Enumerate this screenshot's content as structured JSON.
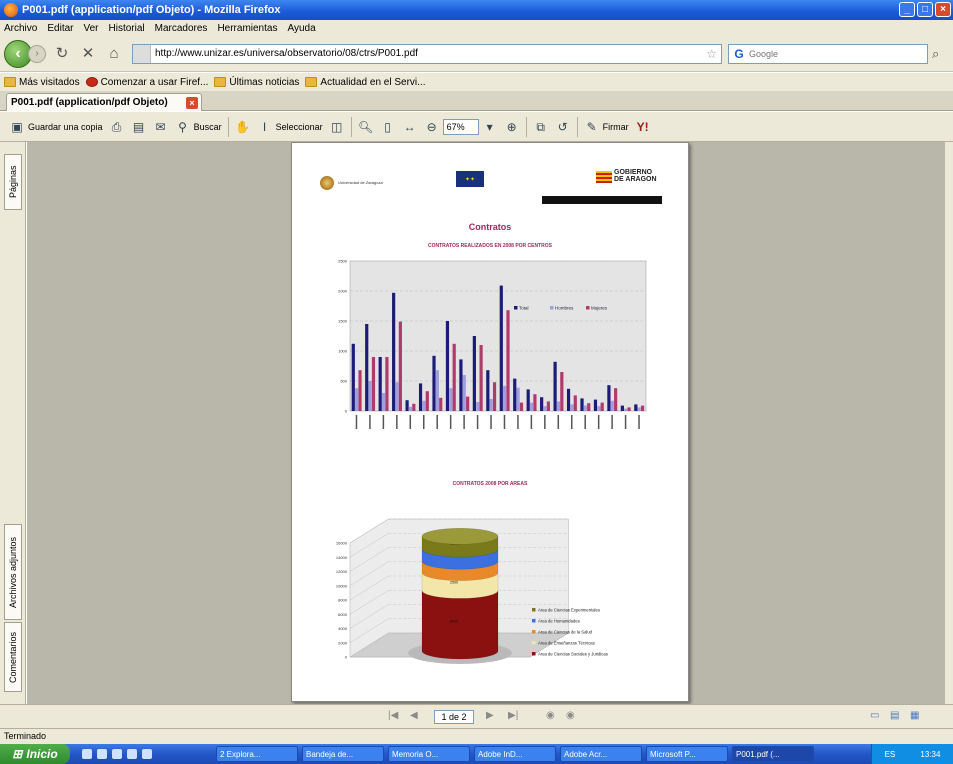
{
  "window": {
    "title": "P001.pdf (application/pdf Objeto) - Mozilla Firefox"
  },
  "menu": [
    "Archivo",
    "Editar",
    "Ver",
    "Historial",
    "Marcadores",
    "Herramientas",
    "Ayuda"
  ],
  "nav": {
    "url": "http://www.unizar.es/universa/observatorio/08/ctrs/P001.pdf",
    "search_placeholder": "Google"
  },
  "bookmarks": [
    "Más visitados",
    "Comenzar a usar Firef...",
    "Últimas noticias",
    "Actualidad en el Servi..."
  ],
  "tab": {
    "label": "P001.pdf (application/pdf Objeto)"
  },
  "pdf_toolbar": {
    "save": "Guardar una copia",
    "search": "Buscar",
    "select": "Seleccionar",
    "zoom": "67%",
    "sign": "Firmar"
  },
  "side_tabs": [
    "Páginas",
    "Archivos adjuntos",
    "Comentarios"
  ],
  "pdf": {
    "logo_uz": "Universidad de Zaragoza",
    "logo_ga": "GOBIERNO DE ARAGON",
    "title": "Contratos",
    "chart1_title": "CONTRATOS REALIZADOS EN 2008 POR CENTROS",
    "chart2_title": "CONTRATOS 2008 POR AREAS"
  },
  "chart_data": [
    {
      "type": "bar",
      "title": "CONTRATOS REALIZADOS EN 2008 POR CENTROS",
      "ylim": [
        0,
        2500
      ],
      "yticks": [
        0,
        500,
        1000,
        1500,
        2000,
        2500
      ],
      "legend": "right",
      "series": [
        {
          "name": "Total",
          "color": "#1c1c78",
          "values": [
            1120,
            1450,
            900,
            1970,
            180,
            460,
            920,
            1500,
            860,
            1250,
            680,
            2090,
            540,
            360,
            230,
            820,
            370,
            210,
            190,
            430,
            90,
            110
          ]
        },
        {
          "name": "Hombres",
          "color": "#9f9fe0",
          "values": [
            380,
            500,
            300,
            480,
            70,
            170,
            680,
            380,
            600,
            150,
            200,
            420,
            390,
            140,
            80,
            160,
            110,
            90,
            80,
            170,
            40,
            60
          ]
        },
        {
          "name": "Mujeres",
          "color": "#b23a6a",
          "values": [
            680,
            900,
            900,
            1490,
            120,
            330,
            220,
            1120,
            240,
            1100,
            480,
            1680,
            140,
            280,
            160,
            650,
            260,
            130,
            140,
            380,
            60,
            90
          ]
        }
      ]
    },
    {
      "type": "bar",
      "title": "CONTRATOS 2008 POR AREAS",
      "ylim": [
        0,
        16000
      ],
      "yticks": [
        0,
        2000,
        4000,
        6000,
        8000,
        10000,
        12000,
        14000,
        16000
      ],
      "legend": "bottom-right",
      "series": [
        {
          "name": "Area de Ciencias Sociales y Juridicas",
          "color": "#8b1010",
          "value": 8500
        },
        {
          "name": "Area de Enseñanzas Técnicas",
          "color": "#f2e6a8",
          "value": 2500
        },
        {
          "name": "Area de Ciencias de la Salud",
          "color": "#e88a2a",
          "value": 1600
        },
        {
          "name": "Area de Humanidades",
          "color": "#3c6fe0",
          "value": 1700
        },
        {
          "name": "Area de Ciencias Experimentales",
          "color": "#7a7a1a",
          "value": 1800
        }
      ]
    }
  ],
  "pagenav": {
    "page": "1 de 2"
  },
  "status": "Terminado",
  "taskbar": {
    "start": "Inicio",
    "tasks": [
      "2 Explora...",
      "Bandeja de...",
      "Memoria O...",
      "Adobe InD...",
      "Adobe Acr...",
      "Microsoft P...",
      "P001.pdf (..."
    ],
    "lang": "ES",
    "clock": "13:34"
  }
}
